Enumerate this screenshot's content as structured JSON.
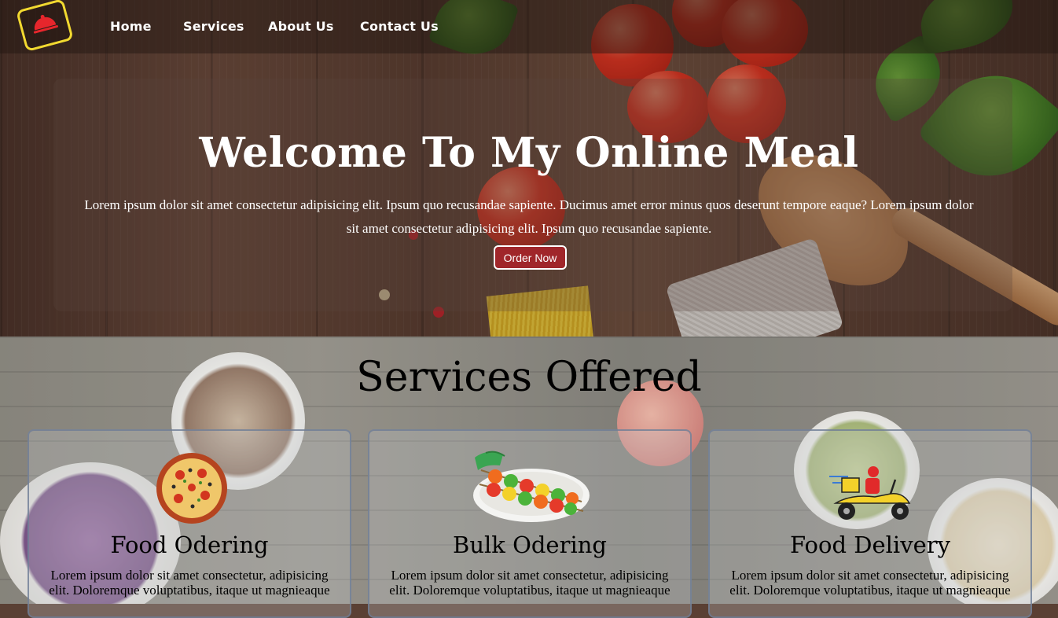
{
  "nav": {
    "logo_icon": "cloche-icon",
    "links": [
      "Home",
      "Services",
      "About Us",
      "Contact Us"
    ]
  },
  "hero": {
    "title": "Welcome To My Online Meal",
    "description": "Lorem ipsum dolor sit amet consectetur adipisicing elit. Ipsum quo recusandae sapiente. Ducimus amet error minus quos deserunt tempore eaque? Lorem ipsum dolor sit amet consectetur adipisicing elit. Ipsum quo recusandae sapiente.",
    "button": "Order Now"
  },
  "services": {
    "title": "Services Offered",
    "cards": [
      {
        "title": "Food Odering",
        "icon": "pizza-icon",
        "description": "Lorem ipsum dolor sit amet consectetur, adipisicing elit. Doloremque voluptatibus, itaque ut magnieaque"
      },
      {
        "title": "Bulk Odering",
        "icon": "skewers-platter-icon",
        "description": "Lorem ipsum dolor sit amet consectetur, adipisicing elit. Doloremque voluptatibus, itaque ut magnieaque"
      },
      {
        "title": "Food Delivery",
        "icon": "delivery-scooter-icon",
        "description": "Lorem ipsum dolor sit amet consectetur, adipisicing elit. Doloremque voluptatibus, itaque ut magnieaque"
      }
    ]
  },
  "colors": {
    "accent_red": "#a0262a",
    "logo_yellow": "#f2d930",
    "nav_text": "#ffffff"
  }
}
